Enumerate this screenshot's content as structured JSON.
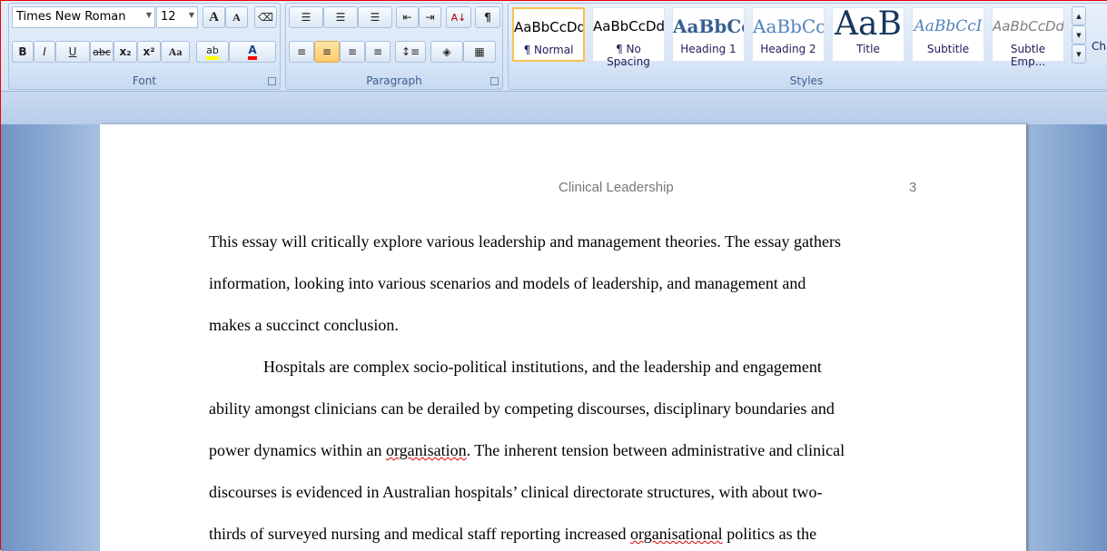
{
  "font_group": {
    "label": "Font",
    "font_name": "Times New Roman",
    "font_size": "12",
    "bold": "B",
    "italic": "I",
    "underline": "U",
    "strike": "abc",
    "subscript": "x₂",
    "superscript": "x²",
    "change_case": "Aa",
    "grow": "A",
    "shrink": "A",
    "highlight_color": "#ffff00",
    "font_color": "#ff0000"
  },
  "paragraph_group": {
    "label": "Paragraph",
    "show_marks": "¶",
    "sort": "A↓"
  },
  "styles_group": {
    "label": "Styles",
    "items": [
      {
        "preview": "AaBbCcDd",
        "name": "¶ Normal",
        "color": "#000000"
      },
      {
        "preview": "AaBbCcDd",
        "name": "¶ No Spacing",
        "color": "#000000"
      },
      {
        "preview": "AaBbCc",
        "name": "Heading 1",
        "color": "#365f91"
      },
      {
        "preview": "AaBbCc",
        "name": "Heading 2",
        "color": "#4f81bd"
      },
      {
        "preview": "AaB",
        "name": "Title",
        "color": "#17365d"
      },
      {
        "preview": "AaBbCcI",
        "name": "Subtitle",
        "color": "#4f81bd"
      },
      {
        "preview": "AaBbCcDd",
        "name": "Subtle Emp...",
        "color": "#808080"
      }
    ],
    "change_styles": "Change Styles"
  },
  "document": {
    "header_title": "Clinical Leadership",
    "page_number": "3",
    "lines": [
      "This essay will critically explore various leadership and management theories. The essay gathers",
      "information, looking into various scenarios and models of leadership, and management and",
      "makes a succinct conclusion.",
      "Hospitals are complex socio-political institutions, and the leadership and engagement",
      "ability amongst clinicians can be derailed by competing discourses, disciplinary boundaries and",
      "power dynamics within an ",
      "discourses is evidenced in Australian hospitals’ clinical directorate structures, with about two-",
      "thirds of surveyed nursing and medical staff reporting increased "
    ],
    "line6_word": "organisation",
    "line6_rest": ". The inherent tension between administrative and clinical",
    "line8_word": "organisational",
    "line8_rest": " politics as the"
  }
}
